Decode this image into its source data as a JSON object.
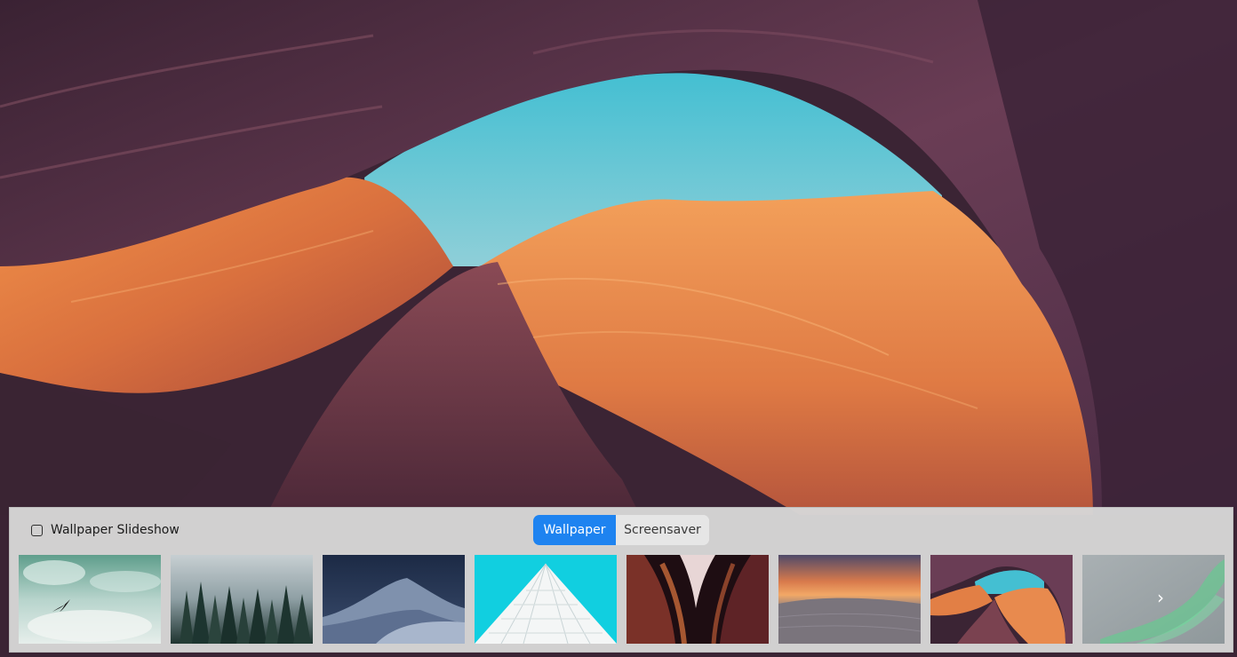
{
  "desktop": {
    "wallpaper_icon": "antelope-canyon-wallpaper"
  },
  "panel": {
    "slideshow_label": "Wallpaper Slideshow",
    "slideshow_checked": false,
    "tabs": [
      {
        "label": "Wallpaper",
        "active": true
      },
      {
        "label": "Screensaver",
        "active": false
      }
    ],
    "accent_color": "#1e83f0",
    "next_glyph": "›",
    "thumbnails": [
      {
        "name": "bird-over-clouds"
      },
      {
        "name": "misty-forest"
      },
      {
        "name": "blue-dunes"
      },
      {
        "name": "white-building"
      },
      {
        "name": "dark-canyon"
      },
      {
        "name": "desert-sunset"
      },
      {
        "name": "antelope-canyon"
      },
      {
        "name": "aurora"
      }
    ]
  }
}
